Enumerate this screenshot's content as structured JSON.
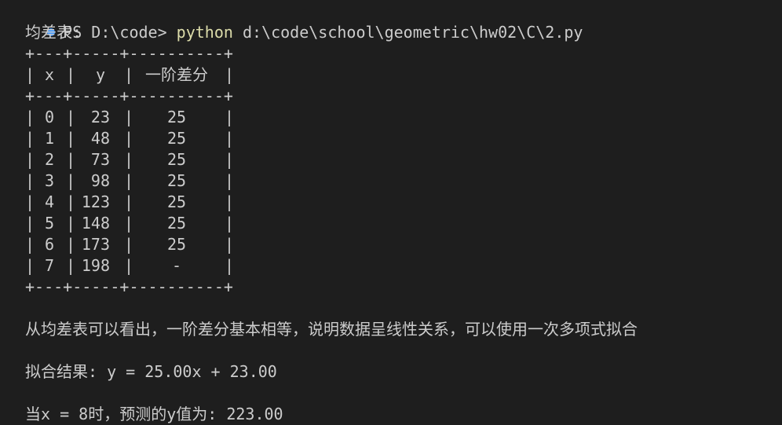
{
  "terminal": {
    "prompt": "PS D:\\code>",
    "command_exe": "python",
    "command_arg": "d:\\code\\school\\geometric\\hw02\\C\\2.py",
    "diff_table_title": "均差表:",
    "border_line": "+---+-----+----------+",
    "header": {
      "x": "x",
      "y": "y",
      "diff": "一阶差分"
    },
    "rows": [
      {
        "x": "0",
        "y": "23",
        "diff": "25"
      },
      {
        "x": "1",
        "y": "48",
        "diff": "25"
      },
      {
        "x": "2",
        "y": "73",
        "diff": "25"
      },
      {
        "x": "3",
        "y": "98",
        "diff": "25"
      },
      {
        "x": "4",
        "y": "123",
        "diff": "25"
      },
      {
        "x": "5",
        "y": "148",
        "diff": "25"
      },
      {
        "x": "6",
        "y": "173",
        "diff": "25"
      },
      {
        "x": "7",
        "y": "198",
        "diff": "-"
      }
    ],
    "conclusion": "从均差表可以看出，一阶差分基本相等，说明数据呈线性关系，可以使用一次多项式拟合",
    "fit_result": "拟合结果: y = 25.00x + 23.00",
    "prediction": "当x = 8时，预测的y值为: 223.00"
  },
  "colors": {
    "background": "#1e1e1e",
    "text": "#cccccc",
    "command": "#dcdcaa",
    "prompt_dot": "#3794ff"
  }
}
